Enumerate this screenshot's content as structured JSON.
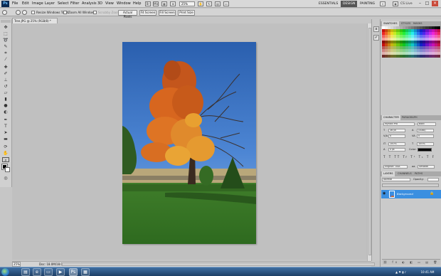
{
  "menubar": {
    "logo": "Ps",
    "items": [
      "File",
      "Edit",
      "Image",
      "Layer",
      "Select",
      "Filter",
      "Analysis",
      "3D",
      "View",
      "Window",
      "Help"
    ],
    "zoom": "25%",
    "workspaces": [
      "ESSENTIALS",
      "DESIGN",
      "PAINTING"
    ],
    "active_workspace": "DESIGN",
    "cs_live": "CS Live"
  },
  "options": {
    "resize_windows": "Resize Windows To Fit",
    "zoom_all": "Zoom All Windows",
    "scrubby_zoom": "Scrubby Zoom",
    "actual_pixels": "Actual Pixels",
    "fit_screen": "Fit Screen",
    "fill_screen": "Fill Screen",
    "print_size": "Print Size"
  },
  "document": {
    "tab_title": "Tree.JPG @ 25% (RGB/8) *",
    "zoom": "25%",
    "doc_size": "Doc: 18.0M/18.0M"
  },
  "panels": {
    "swatch_tabs": [
      "SWATCHES",
      "STYLES",
      "MASKS"
    ],
    "character_tabs": [
      "CHARACTER",
      "PARAGRAPH"
    ],
    "font_family": "Myriad Pro",
    "font_style": "Bold",
    "font_size": "36 pt",
    "leading": "(Auto)",
    "kerning": "0",
    "tracking": "0",
    "vscale": "100%",
    "hscale": "100%",
    "baseline": "0 pt",
    "color_label": "Color:",
    "language": "English: USA",
    "aa": "Smooth",
    "layers_tabs": [
      "LAYERS",
      "CHANNELS",
      "PATHS"
    ],
    "blend_mode": "Normal",
    "opacity_label": "Opacity:",
    "layer_name": "Background"
  },
  "taskbar": {
    "clock": "10:41 AM"
  },
  "colors": {
    "fg": "#000000",
    "bg": "#ffffff",
    "layer_selected": "#3b8fe0"
  }
}
